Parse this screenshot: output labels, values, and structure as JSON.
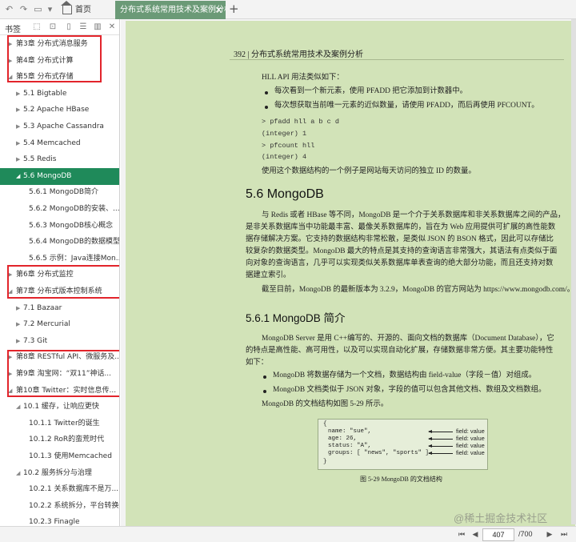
{
  "tabs": {
    "home": "首页",
    "document": "分布式系统常用技术及案例分析"
  },
  "sidebar": {
    "title": "书签",
    "items": [
      {
        "label": "第3章   分布式消息服务",
        "arrow": "▶"
      },
      {
        "label": "第4章   分布式计算",
        "arrow": "▶"
      },
      {
        "label": "第5章   分布式存储",
        "arrow": "◢"
      },
      {
        "label": "5.1    Bigtable",
        "arrow": "▶"
      },
      {
        "label": "5.2    Apache HBase",
        "arrow": "▶"
      },
      {
        "label": "5.3    Apache Cassandra",
        "arrow": "▶"
      },
      {
        "label": "5.4    Memcached",
        "arrow": "▶"
      },
      {
        "label": "5.5    Redis",
        "arrow": "▶"
      },
      {
        "label": "5.6    MongoDB",
        "arrow": "◢"
      },
      {
        "label": "5.6.1    MongoDB简介",
        "arrow": ""
      },
      {
        "label": "5.6.2    MongoDB的安装、...",
        "arrow": ""
      },
      {
        "label": "5.6.3    MongoDB核心概念",
        "arrow": ""
      },
      {
        "label": "5.6.4    MongoDB的数据模型",
        "arrow": ""
      },
      {
        "label": "5.6.5    示例：Java连接Mon...",
        "arrow": ""
      },
      {
        "label": "第6章   分布式监控",
        "arrow": "▶"
      },
      {
        "label": "第7章   分布式版本控制系统",
        "arrow": "◢"
      },
      {
        "label": "7.1    Bazaar",
        "arrow": "▶"
      },
      {
        "label": "7.2    Mercurial",
        "arrow": "▶"
      },
      {
        "label": "7.3    Git",
        "arrow": "▶"
      },
      {
        "label": "第8章   RESTful API、微服务及...",
        "arrow": "▶"
      },
      {
        "label": "第9章   淘宝网：“双11”神话...",
        "arrow": "▶"
      },
      {
        "label": "第10章   Twitter：实时信息传...",
        "arrow": "◢"
      },
      {
        "label": "10.1    缓存，让响应更快",
        "arrow": "◢"
      },
      {
        "label": "10.1.1    Twitter的诞生",
        "arrow": ""
      },
      {
        "label": "10.1.2    RoR的蛮荒时代",
        "arrow": ""
      },
      {
        "label": "10.1.3    使用Memcached",
        "arrow": ""
      },
      {
        "label": "10.2    服务拆分与治理",
        "arrow": "◢"
      },
      {
        "label": "10.2.1    关系数据库不是万...",
        "arrow": ""
      },
      {
        "label": "10.2.2    系统拆分，平台转换",
        "arrow": ""
      },
      {
        "label": "10.2.3    Finagle",
        "arrow": ""
      }
    ]
  },
  "page": {
    "header": "392    |    分布式系统常用技术及案例分析",
    "intro": "HLL API 用法类似如下：",
    "bullets1": [
      "每次看到一个新元素，使用 PFADD 把它添加到计数器中。",
      "每次想获取当前唯一元素的近似数量，请使用 PFADD，而后再使用 PFCOUNT。"
    ],
    "code": [
      "> pfadd hll a b c d",
      "(integer) 1",
      "> pfcount hll",
      "(integer) 4"
    ],
    "after_code": "使用这个数据结构的一个例子是网站每天访问的独立 ID 的数量。",
    "h2": "5.6    MongoDB",
    "para1": [
      "与 Redis 或者 HBase 等不同，MongoDB 是一个介于关系数据库和非关系数据库之间的产品，",
      "是非关系数据库当中功能最丰富、最像关系数据库的，旨在为 Web 应用提供可扩展的高性能数",
      "据存储解决方案。它支持的数据结构非常松散，是类似 JSON 的 BSON 格式，因此可以存储比",
      "较复杂的数据类型。MongoDB 最大的特点是其支持的查询语言非常强大，其语法有点类似于面",
      "向对象的查询语言，几乎可以实现类似关系数据库单表查询的绝大部分功能，而且还支持对数",
      "据建立索引。"
    ],
    "para2": "截至目前，MongoDB 的最新版本为 3.2.9，MongoDB 的官方网站为 https://www.mongodb.com/。",
    "h3": "5.6.1    MongoDB 简介",
    "para3": [
      "MongoDB Server 是用 C++编写的、开源的、面向文档的数据库（Document Database），它",
      "的特点是高性能、高可用性，以及可以实现自动化扩展，存储数据非常方便。其主要功能特性",
      "如下："
    ],
    "bullets2": [
      "MongoDB 将数据存储为一个文档，数据结构由 field-value（字段－值）对组成。",
      "MongoDB 文档类似于 JSON 对象，字段的值可以包含其他文档、数组及文档数组。"
    ],
    "para4": "MongoDB 的文档结构如图 5-29 所示。",
    "figure": {
      "brace_open": "{",
      "lines": [
        "name: \"sue\",",
        "age: 26,",
        "status: \"A\",",
        "groups: [ \"news\", \"sports\" ]"
      ],
      "brace_close": "}",
      "labels": [
        "field: value",
        "field: value",
        "field: value",
        "field: value"
      ]
    },
    "caption": "图 5-29    MongoDB 的文档结构",
    "watermark": "@稀土掘金技术社区"
  },
  "footer": {
    "current_page": "407",
    "total_pages": "/700"
  },
  "colors": {
    "accent": "#1f8a5a",
    "tab": "#6b9a77",
    "page_bg": "#d2e3b8",
    "highlight": "#e2242b"
  }
}
